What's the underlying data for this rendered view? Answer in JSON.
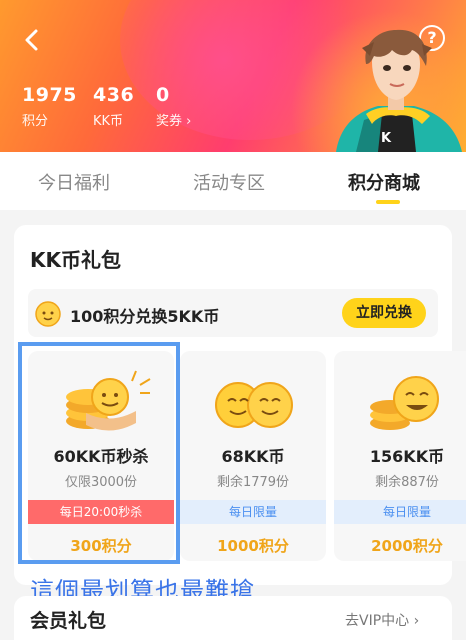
{
  "header": {
    "back_icon": "chevron-left-icon",
    "help_label": "?",
    "stats": [
      {
        "value": "1975",
        "label": "积分"
      },
      {
        "value": "436",
        "label": "KK币"
      },
      {
        "value": "0",
        "label": "奖券 ›"
      }
    ]
  },
  "tabs": [
    {
      "label": "今日福利",
      "active": false
    },
    {
      "label": "活动专区",
      "active": false
    },
    {
      "label": "积分商城",
      "active": true
    }
  ],
  "kk_section": {
    "title": "KK币礼包",
    "exchange_text": "100积分兑换5KK币",
    "exchange_button": "立即兑换"
  },
  "items": [
    {
      "name": "60KK币秒杀",
      "sub": "仅限3000份",
      "tag": "每日20:00秒杀",
      "price": "300积分"
    },
    {
      "name": "68KK币",
      "sub": "剩余1779份",
      "tag": "每日限量",
      "price": "1000积分"
    },
    {
      "name": "156KK币",
      "sub": "剩余887份",
      "tag": "每日限量",
      "price": "2000积分"
    }
  ],
  "annotation": "這個最划算也最難搶",
  "vip_section": {
    "title": "会员礼包",
    "link": "去VIP中心 ›"
  },
  "colors": {
    "accent_yellow": "#ffd31a",
    "price_orange": "#f0a51a",
    "tag_red": "#ff6a6a",
    "annotation_blue": "#3a74e8"
  }
}
